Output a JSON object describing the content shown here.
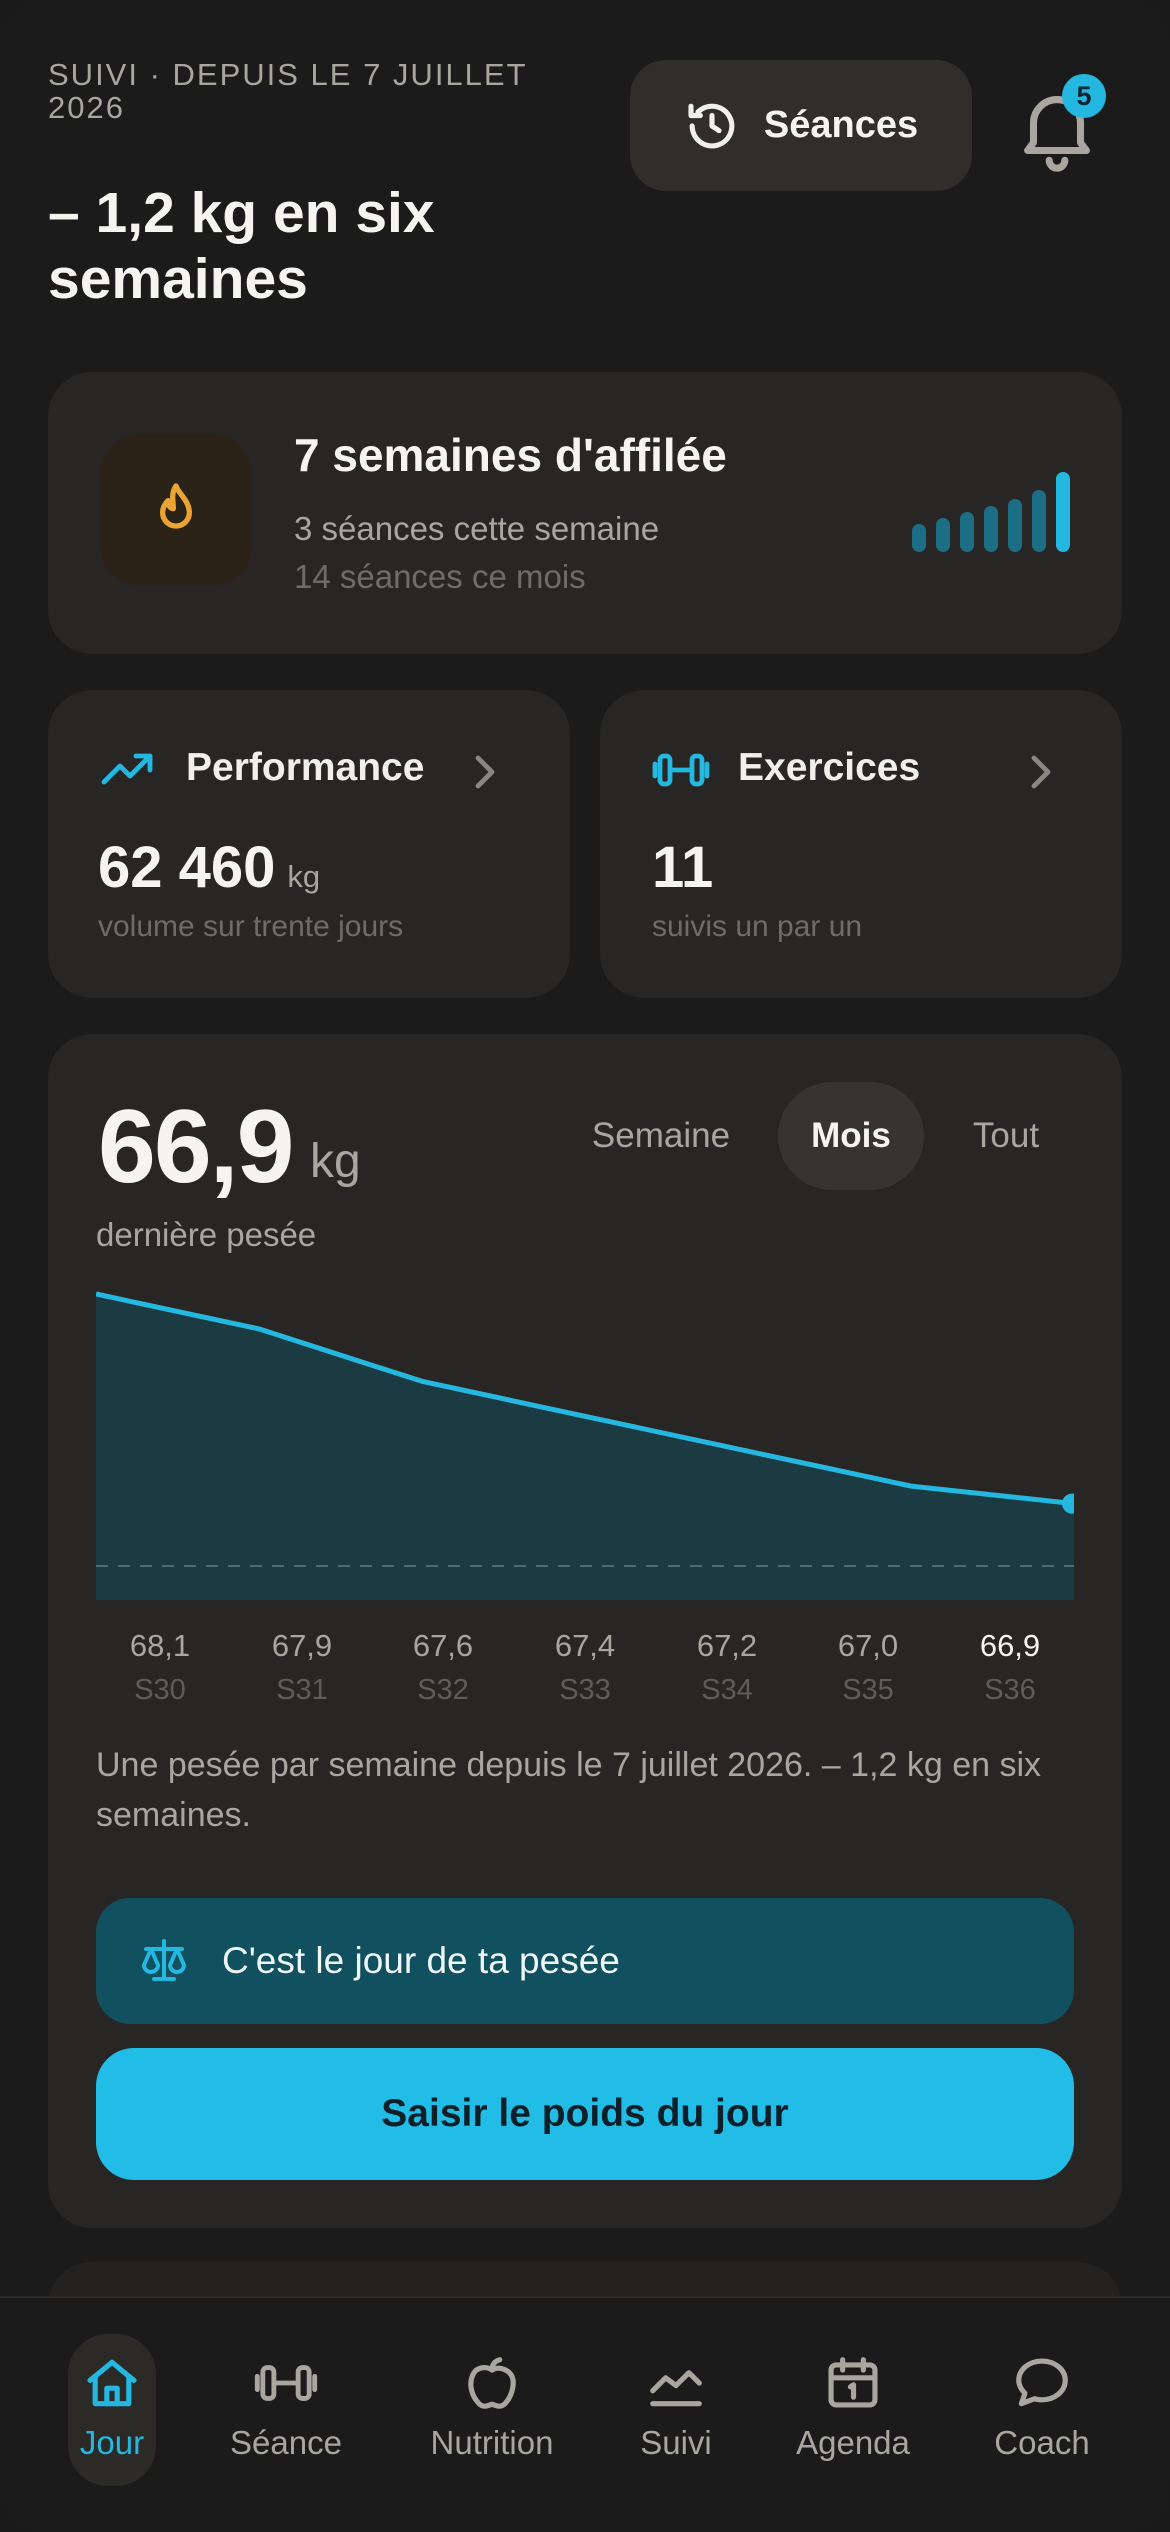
{
  "header": {
    "eyebrow": "SUIVI · DEPUIS LE 7 JUILLET 2026",
    "headline_line1": "– 1,2 kg en six",
    "headline_line2": "semaines",
    "seances_label": "Séances",
    "notification_count": "5"
  },
  "streak": {
    "title": "7 semaines d'affilée",
    "sub1": "3 séances cette semaine",
    "sub2": "14 séances ce mois",
    "bar_levels": [
      0.35,
      0.42,
      0.5,
      0.58,
      0.66,
      0.78,
      1.0
    ]
  },
  "performance": {
    "title": "Performance",
    "value": "62 460",
    "unit": "kg",
    "sub": "volume sur trente jours"
  },
  "exercices": {
    "title": "Exercices",
    "value": "11",
    "sub": "suivis un par un"
  },
  "weight": {
    "value": "66,9",
    "unit": "kg",
    "label": "dernière pesée",
    "ranges": [
      "Semaine",
      "Mois",
      "Tout"
    ],
    "active_range": "Mois",
    "note": "Une pesée par semaine depuis le 7 juillet 2026. – 1,2 kg en six semaines.",
    "reminder": "C'est le jour de ta pesée",
    "cta": "Saisir le poids du jour"
  },
  "chart_data": {
    "type": "area",
    "x": [
      "S30",
      "S31",
      "S32",
      "S33",
      "S34",
      "S35",
      "S36"
    ],
    "values": [
      68.1,
      67.9,
      67.6,
      67.4,
      67.2,
      67.0,
      66.9
    ],
    "value_labels": [
      "68,1",
      "67,9",
      "67,6",
      "67,4",
      "67,2",
      "67,0",
      "66,9"
    ],
    "ylim": [
      66.6,
      68.1
    ],
    "reference_line": 66.6,
    "grid": false
  },
  "colors": {
    "accent": "#24b8e0",
    "flame": "#e9a432",
    "area_fill": "#1b3a41",
    "card": "#272624"
  },
  "tabbar": {
    "items": [
      {
        "label": "Jour",
        "icon": "home-icon"
      },
      {
        "label": "Séance",
        "icon": "dumbbell-icon"
      },
      {
        "label": "Nutrition",
        "icon": "apple-icon"
      },
      {
        "label": "Suivi",
        "icon": "trend-chart-icon"
      },
      {
        "label": "Agenda",
        "icon": "calendar-icon"
      },
      {
        "label": "Coach",
        "icon": "chat-bubble-icon"
      }
    ],
    "active": "Jour"
  }
}
